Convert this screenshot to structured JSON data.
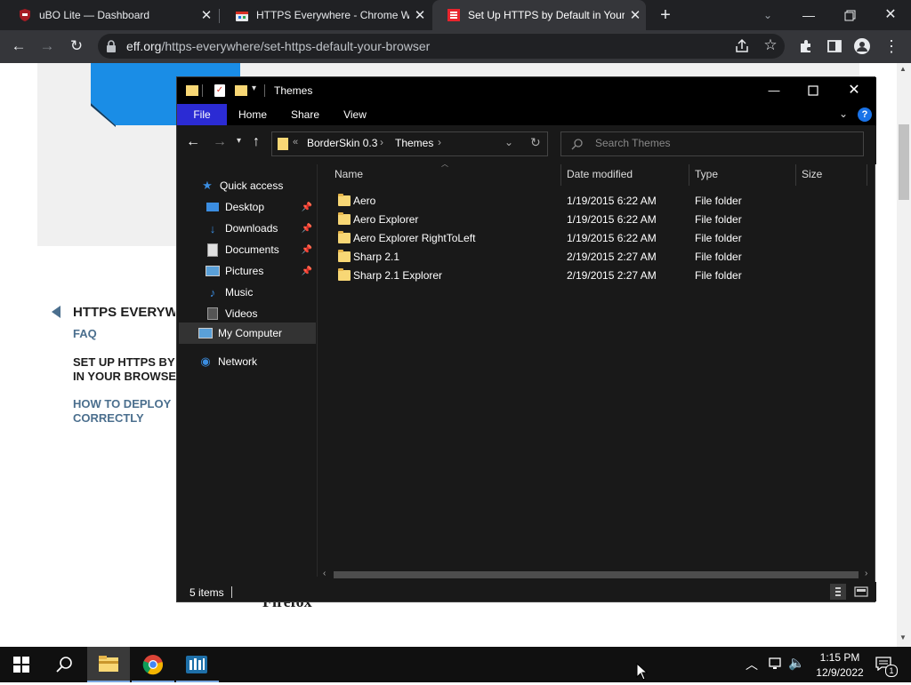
{
  "browser": {
    "tabs": [
      {
        "title": "uBO Lite — Dashboard",
        "active": false
      },
      {
        "title": "HTTPS Everywhere - Chrome Web Store",
        "active": false
      },
      {
        "title": "Set Up HTTPS by Default in Your Browser",
        "active": true
      }
    ],
    "new_tab": "+",
    "url_host": "eff.org",
    "url_path": "/https-everywhere/set-https-default-your-browser"
  },
  "page": {
    "nav_title": "HTTPS EVERYWHERE",
    "faq": "FAQ",
    "set_up": "SET UP HTTPS BY DEFAULT IN YOUR BROWSER",
    "set_up_line1": "SET UP HTTPS BY",
    "set_up_line2": "IN YOUR BROWSE",
    "deploy_line1": "HOW TO DEPLOY",
    "deploy_line2": "CORRECTLY",
    "firefox": "Firefox"
  },
  "explorer": {
    "title": "Themes",
    "ribbon_tabs": [
      "File",
      "Home",
      "Share",
      "View"
    ],
    "breadcrumb": [
      "BorderSkin 0.3",
      "Themes"
    ],
    "breadcrumb_overflow": "«",
    "search_placeholder": "Search Themes",
    "nav": {
      "quick_access": "Quick access",
      "desktop": "Desktop",
      "downloads": "Downloads",
      "documents": "Documents",
      "pictures": "Pictures",
      "music": "Music",
      "videos": "Videos",
      "my_computer": "My Computer",
      "network": "Network"
    },
    "columns": [
      "Name",
      "Date modified",
      "Type",
      "Size"
    ],
    "files": [
      {
        "name": "Aero",
        "date": "1/19/2015 6:22 AM",
        "type": "File folder"
      },
      {
        "name": "Aero Explorer",
        "date": "1/19/2015 6:22 AM",
        "type": "File folder"
      },
      {
        "name": "Aero Explorer RightToLeft",
        "date": "1/19/2015 6:22 AM",
        "type": "File folder"
      },
      {
        "name": "Sharp 2.1",
        "date": "2/19/2015 2:27 AM",
        "type": "File folder"
      },
      {
        "name": "Sharp 2.1 Explorer",
        "date": "2/19/2015 2:27 AM",
        "type": "File folder"
      }
    ],
    "status": "5 items"
  },
  "taskbar": {
    "time": "1:15 PM",
    "date": "12/9/2022",
    "notification_count": "1"
  },
  "colors": {
    "chrome_dark": "#202124",
    "chrome_toolbar": "#35363a",
    "explorer_bg": "#191919",
    "file_tab": "#2b2bd4",
    "folder": "#f8d775",
    "eff_blue": "#1a8de6",
    "nav_link": "#4b6f8e"
  }
}
